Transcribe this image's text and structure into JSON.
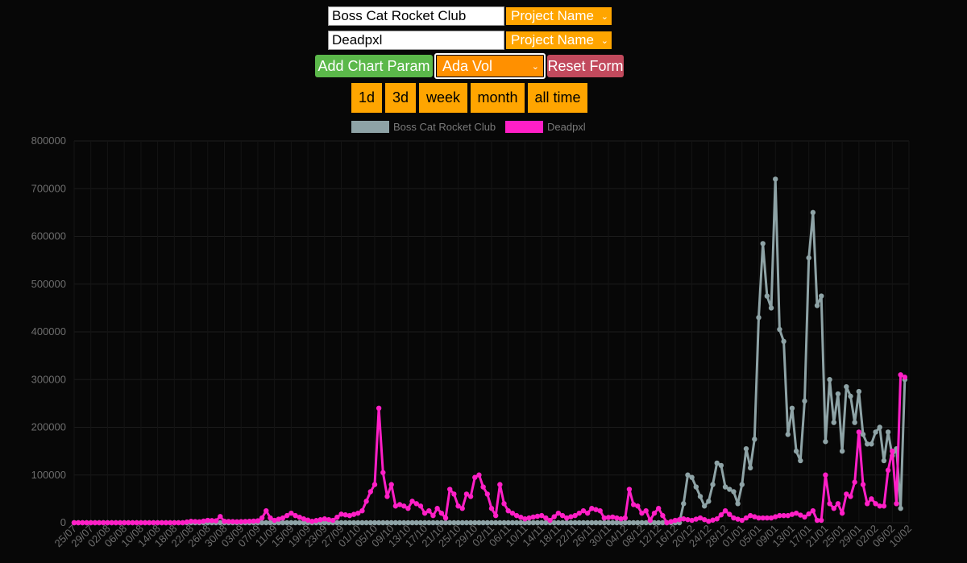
{
  "form": {
    "project1_value": "Boss Cat Rocket Club",
    "project2_value": "Deadpxl",
    "select_label": "Project Name",
    "add_param_label": "Add Chart Param",
    "param_select_label": "Ada Vol",
    "reset_label": "Reset Form"
  },
  "time_buttons": [
    "1d",
    "3d",
    "week",
    "month",
    "all time"
  ],
  "colors": {
    "bccr": "#8ea3a6",
    "deadpxl": "#ff1fc6",
    "orange": "#ffa500",
    "green": "#5bb84a",
    "red": "#c24a5d"
  },
  "chart_data": {
    "type": "line",
    "title": "",
    "xlabel": "",
    "ylabel": "",
    "ylim": [
      0,
      800000
    ],
    "yticks": [
      0,
      100000,
      200000,
      300000,
      400000,
      500000,
      600000,
      700000,
      800000
    ],
    "x_tick_labels": [
      "25/07",
      "29/07",
      "02/08",
      "06/08",
      "10/08",
      "14/08",
      "18/08",
      "22/08",
      "26/08",
      "30/08",
      "03/09",
      "07/09",
      "11/09",
      "15/09",
      "19/09",
      "23/09",
      "27/09",
      "01/10",
      "05/10",
      "09/10",
      "13/10",
      "17/10",
      "21/10",
      "25/10",
      "29/10",
      "02/11",
      "06/11",
      "10/11",
      "14/11",
      "18/11",
      "22/11",
      "26/11",
      "30/11",
      "04/12",
      "08/12",
      "12/12",
      "16/12",
      "20/12",
      "24/12",
      "28/12",
      "01/01",
      "05/01",
      "09/01",
      "13/01",
      "17/01",
      "21/01",
      "25/01",
      "29/01",
      "02/02",
      "06/02",
      "10/02"
    ],
    "legend": {
      "placement": "top-center"
    },
    "grid": true,
    "series": [
      {
        "name": "Boss Cat Rocket Club",
        "color": "#8ea3a6",
        "points": [
          {
            "d": "17/12",
            "y": 0
          },
          {
            "d": "18/12",
            "y": 40000
          },
          {
            "d": "19/12",
            "y": 100000
          },
          {
            "d": "20/12",
            "y": 95000
          },
          {
            "d": "21/12",
            "y": 75000
          },
          {
            "d": "22/12",
            "y": 55000
          },
          {
            "d": "23/12",
            "y": 35000
          },
          {
            "d": "24/12",
            "y": 45000
          },
          {
            "d": "25/12",
            "y": 80000
          },
          {
            "d": "26/12",
            "y": 125000
          },
          {
            "d": "27/12",
            "y": 120000
          },
          {
            "d": "28/12",
            "y": 75000
          },
          {
            "d": "29/12",
            "y": 70000
          },
          {
            "d": "30/12",
            "y": 65000
          },
          {
            "d": "31/12",
            "y": 40000
          },
          {
            "d": "01/01",
            "y": 80000
          },
          {
            "d": "02/01",
            "y": 155000
          },
          {
            "d": "03/01",
            "y": 115000
          },
          {
            "d": "04/01",
            "y": 175000
          },
          {
            "d": "05/01",
            "y": 430000
          },
          {
            "d": "06/01",
            "y": 585000
          },
          {
            "d": "07/01",
            "y": 475000
          },
          {
            "d": "08/01",
            "y": 450000
          },
          {
            "d": "09/01",
            "y": 720000
          },
          {
            "d": "10/01",
            "y": 405000
          },
          {
            "d": "11/01",
            "y": 380000
          },
          {
            "d": "12/01",
            "y": 185000
          },
          {
            "d": "13/01",
            "y": 240000
          },
          {
            "d": "14/01",
            "y": 150000
          },
          {
            "d": "15/01",
            "y": 130000
          },
          {
            "d": "16/01",
            "y": 255000
          },
          {
            "d": "17/01",
            "y": 555000
          },
          {
            "d": "18/01",
            "y": 650000
          },
          {
            "d": "19/01",
            "y": 455000
          },
          {
            "d": "20/01",
            "y": 475000
          },
          {
            "d": "21/01",
            "y": 170000
          },
          {
            "d": "22/01",
            "y": 300000
          },
          {
            "d": "23/01",
            "y": 210000
          },
          {
            "d": "24/01",
            "y": 270000
          },
          {
            "d": "25/01",
            "y": 150000
          },
          {
            "d": "26/01",
            "y": 285000
          },
          {
            "d": "27/01",
            "y": 265000
          },
          {
            "d": "28/01",
            "y": 210000
          },
          {
            "d": "29/01",
            "y": 275000
          },
          {
            "d": "30/01",
            "y": 185000
          },
          {
            "d": "31/01",
            "y": 165000
          },
          {
            "d": "01/02",
            "y": 165000
          },
          {
            "d": "02/02",
            "y": 190000
          },
          {
            "d": "03/02",
            "y": 200000
          },
          {
            "d": "04/02",
            "y": 130000
          },
          {
            "d": "05/02",
            "y": 190000
          },
          {
            "d": "06/02",
            "y": 140000
          },
          {
            "d": "07/02",
            "y": 155000
          },
          {
            "d": "08/02",
            "y": 30000
          },
          {
            "d": "09/02",
            "y": 300000
          }
        ]
      },
      {
        "name": "Deadpxl",
        "color": "#ff1fc6",
        "points": [
          {
            "d": "20/08",
            "y": 0
          },
          {
            "d": "22/08",
            "y": 3000
          },
          {
            "d": "24/08",
            "y": 2000
          },
          {
            "d": "26/08",
            "y": 5000
          },
          {
            "d": "28/08",
            "y": 4000
          },
          {
            "d": "29/08",
            "y": 13000
          },
          {
            "d": "30/08",
            "y": 3000
          },
          {
            "d": "02/09",
            "y": 2000
          },
          {
            "d": "05/09",
            "y": 3000
          },
          {
            "d": "07/09",
            "y": 4000
          },
          {
            "d": "08/09",
            "y": 10000
          },
          {
            "d": "09/09",
            "y": 25000
          },
          {
            "d": "10/09",
            "y": 10000
          },
          {
            "d": "11/09",
            "y": 5000
          },
          {
            "d": "13/09",
            "y": 10000
          },
          {
            "d": "15/09",
            "y": 20000
          },
          {
            "d": "16/09",
            "y": 15000
          },
          {
            "d": "18/09",
            "y": 8000
          },
          {
            "d": "20/09",
            "y": 3000
          },
          {
            "d": "23/09",
            "y": 8000
          },
          {
            "d": "25/09",
            "y": 5000
          },
          {
            "d": "27/09",
            "y": 18000
          },
          {
            "d": "29/09",
            "y": 15000
          },
          {
            "d": "01/10",
            "y": 20000
          },
          {
            "d": "02/10",
            "y": 25000
          },
          {
            "d": "03/10",
            "y": 45000
          },
          {
            "d": "04/10",
            "y": 65000
          },
          {
            "d": "05/10",
            "y": 80000
          },
          {
            "d": "06/10",
            "y": 240000
          },
          {
            "d": "07/10",
            "y": 105000
          },
          {
            "d": "08/10",
            "y": 55000
          },
          {
            "d": "09/10",
            "y": 80000
          },
          {
            "d": "10/10",
            "y": 35000
          },
          {
            "d": "11/10",
            "y": 38000
          },
          {
            "d": "12/10",
            "y": 35000
          },
          {
            "d": "13/10",
            "y": 30000
          },
          {
            "d": "14/10",
            "y": 45000
          },
          {
            "d": "15/10",
            "y": 40000
          },
          {
            "d": "16/10",
            "y": 35000
          },
          {
            "d": "17/10",
            "y": 20000
          },
          {
            "d": "18/10",
            "y": 25000
          },
          {
            "d": "19/10",
            "y": 15000
          },
          {
            "d": "20/10",
            "y": 30000
          },
          {
            "d": "21/10",
            "y": 20000
          },
          {
            "d": "22/10",
            "y": 10000
          },
          {
            "d": "23/10",
            "y": 70000
          },
          {
            "d": "24/10",
            "y": 60000
          },
          {
            "d": "25/10",
            "y": 35000
          },
          {
            "d": "26/10",
            "y": 30000
          },
          {
            "d": "27/10",
            "y": 60000
          },
          {
            "d": "28/10",
            "y": 55000
          },
          {
            "d": "29/10",
            "y": 95000
          },
          {
            "d": "30/10",
            "y": 100000
          },
          {
            "d": "31/10",
            "y": 75000
          },
          {
            "d": "01/11",
            "y": 60000
          },
          {
            "d": "02/11",
            "y": 30000
          },
          {
            "d": "03/11",
            "y": 15000
          },
          {
            "d": "04/11",
            "y": 80000
          },
          {
            "d": "05/11",
            "y": 40000
          },
          {
            "d": "06/11",
            "y": 25000
          },
          {
            "d": "08/11",
            "y": 15000
          },
          {
            "d": "10/11",
            "y": 8000
          },
          {
            "d": "12/11",
            "y": 12000
          },
          {
            "d": "14/11",
            "y": 15000
          },
          {
            "d": "16/11",
            "y": 5000
          },
          {
            "d": "18/11",
            "y": 20000
          },
          {
            "d": "20/11",
            "y": 10000
          },
          {
            "d": "22/11",
            "y": 15000
          },
          {
            "d": "24/11",
            "y": 25000
          },
          {
            "d": "25/11",
            "y": 20000
          },
          {
            "d": "26/11",
            "y": 30000
          },
          {
            "d": "28/11",
            "y": 25000
          },
          {
            "d": "29/11",
            "y": 10000
          },
          {
            "d": "01/12",
            "y": 12000
          },
          {
            "d": "03/12",
            "y": 8000
          },
          {
            "d": "04/12",
            "y": 10000
          },
          {
            "d": "05/12",
            "y": 70000
          },
          {
            "d": "06/12",
            "y": 38000
          },
          {
            "d": "07/12",
            "y": 35000
          },
          {
            "d": "08/12",
            "y": 20000
          },
          {
            "d": "09/12",
            "y": 25000
          },
          {
            "d": "10/12",
            "y": 5000
          },
          {
            "d": "11/12",
            "y": 20000
          },
          {
            "d": "12/12",
            "y": 30000
          },
          {
            "d": "13/12",
            "y": 15000
          },
          {
            "d": "14/12",
            "y": 0
          },
          {
            "d": "16/12",
            "y": 5000
          },
          {
            "d": "18/12",
            "y": 8000
          },
          {
            "d": "20/12",
            "y": 5000
          },
          {
            "d": "22/12",
            "y": 10000
          },
          {
            "d": "24/12",
            "y": 3000
          },
          {
            "d": "26/12",
            "y": 8000
          },
          {
            "d": "28/12",
            "y": 25000
          },
          {
            "d": "30/12",
            "y": 10000
          },
          {
            "d": "01/01",
            "y": 5000
          },
          {
            "d": "03/01",
            "y": 15000
          },
          {
            "d": "05/01",
            "y": 10000
          },
          {
            "d": "08/01",
            "y": 10000
          },
          {
            "d": "10/01",
            "y": 15000
          },
          {
            "d": "12/01",
            "y": 15000
          },
          {
            "d": "14/01",
            "y": 20000
          },
          {
            "d": "16/01",
            "y": 12000
          },
          {
            "d": "18/01",
            "y": 25000
          },
          {
            "d": "19/01",
            "y": 5000
          },
          {
            "d": "20/01",
            "y": 5000
          },
          {
            "d": "21/01",
            "y": 100000
          },
          {
            "d": "22/01",
            "y": 40000
          },
          {
            "d": "23/01",
            "y": 30000
          },
          {
            "d": "24/01",
            "y": 40000
          },
          {
            "d": "25/01",
            "y": 20000
          },
          {
            "d": "26/01",
            "y": 60000
          },
          {
            "d": "27/01",
            "y": 55000
          },
          {
            "d": "28/01",
            "y": 85000
          },
          {
            "d": "29/01",
            "y": 190000
          },
          {
            "d": "30/01",
            "y": 80000
          },
          {
            "d": "31/01",
            "y": 40000
          },
          {
            "d": "01/02",
            "y": 50000
          },
          {
            "d": "02/02",
            "y": 40000
          },
          {
            "d": "03/02",
            "y": 35000
          },
          {
            "d": "04/02",
            "y": 35000
          },
          {
            "d": "05/02",
            "y": 110000
          },
          {
            "d": "06/02",
            "y": 150000
          },
          {
            "d": "07/02",
            "y": 40000
          },
          {
            "d": "08/02",
            "y": 310000
          },
          {
            "d": "09/02",
            "y": 305000
          }
        ]
      }
    ]
  }
}
